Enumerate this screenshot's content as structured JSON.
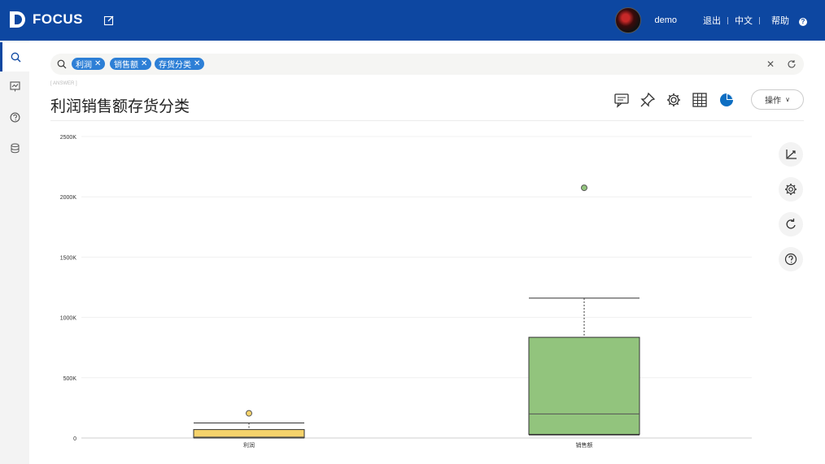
{
  "app": {
    "name": "FOCUS"
  },
  "user": {
    "name": "demo",
    "logout": "退出",
    "language": "中文",
    "help": "帮助"
  },
  "search": {
    "tags": [
      "利润",
      "销售额",
      "存货分类"
    ]
  },
  "answer": {
    "label": "[ ANSWER ]",
    "title": "利润销售额存货分类"
  },
  "toolbar": {
    "operate_label": "操作"
  },
  "colors": {
    "topbar": "#0d47a1",
    "box_profit": "#f6d36b",
    "box_sales": "#92c47d",
    "tag": "#2d7fd6"
  },
  "chart_data": {
    "type": "boxplot",
    "categories": [
      "利润",
      "销售额"
    ],
    "y_ticks": [
      "0",
      "500K",
      "1000K",
      "1500K",
      "2000K",
      "2500K"
    ],
    "ylim": [
      0,
      2500000
    ],
    "series": [
      {
        "category": "利润",
        "min": 0,
        "q1": 2000,
        "median": 8000,
        "q3": 70000,
        "max": 125000,
        "outliers": [
          205000
        ],
        "color": "#f6d36b"
      },
      {
        "category": "销售额",
        "min": 25000,
        "q1": 30000,
        "median": 200000,
        "q3": 835000,
        "max": 1160000,
        "outliers": [
          2075000
        ],
        "color": "#92c47d"
      }
    ]
  }
}
